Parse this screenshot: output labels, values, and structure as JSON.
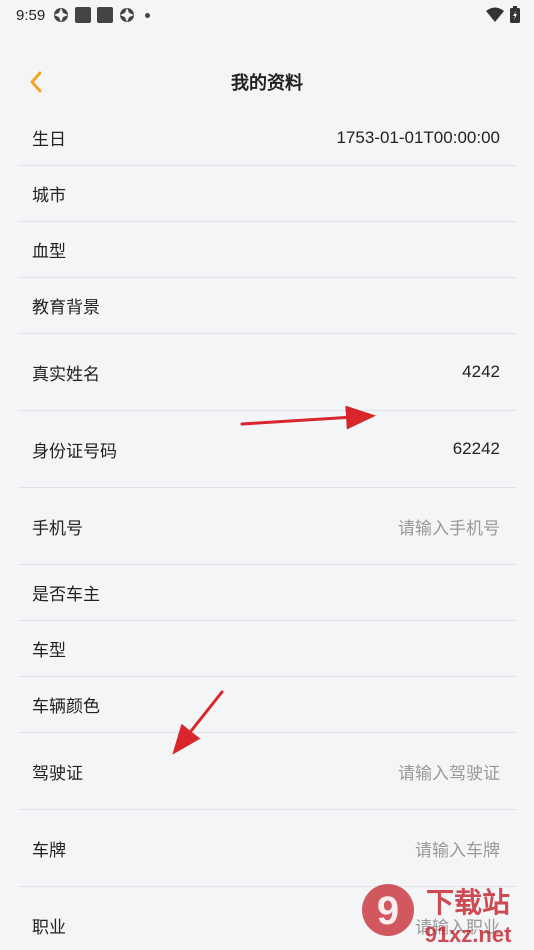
{
  "status_bar": {
    "time": "9:59"
  },
  "header": {
    "title": "我的资料"
  },
  "rows": [
    {
      "label": "生日",
      "value": "1753-01-01T00:00:00",
      "placeholder": false
    },
    {
      "label": "城市",
      "value": "",
      "placeholder": false
    },
    {
      "label": "血型",
      "value": "",
      "placeholder": false
    },
    {
      "label": "教育背景",
      "value": "",
      "placeholder": false
    },
    {
      "label": "真实姓名",
      "value": "4242",
      "placeholder": false
    },
    {
      "label": "身份证号码",
      "value": "62242",
      "placeholder": false
    },
    {
      "label": "手机号",
      "value": "请输入手机号",
      "placeholder": true
    },
    {
      "label": "是否车主",
      "value": "",
      "placeholder": false
    },
    {
      "label": "车型",
      "value": "",
      "placeholder": false
    },
    {
      "label": "车辆颜色",
      "value": "",
      "placeholder": false
    },
    {
      "label": "驾驶证",
      "value": "请输入驾驶证",
      "placeholder": true
    },
    {
      "label": "车牌",
      "value": "请输入车牌",
      "placeholder": true
    },
    {
      "label": "职业",
      "value": "请输入职业",
      "placeholder": true
    }
  ],
  "watermark": {
    "brand": "下载站",
    "domain": "91xz.net",
    "number": "9"
  },
  "colors": {
    "accent": "#f5a623",
    "arrow": "#d8262c",
    "background": "#f4f5f7"
  }
}
